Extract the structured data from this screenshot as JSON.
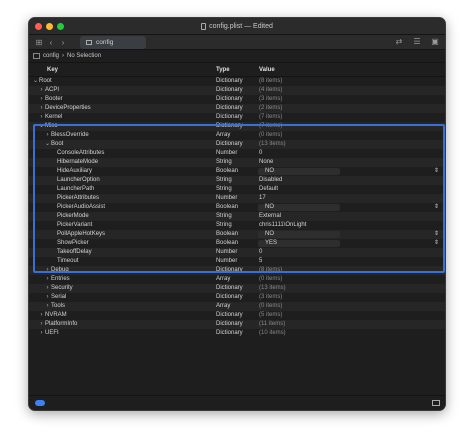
{
  "window": {
    "title": "config.plist — Edited"
  },
  "toolbar": {
    "tab_label": "config"
  },
  "pathbar": {
    "root": "config",
    "selection": "No Selection"
  },
  "columns": {
    "key": "Key",
    "type": "Type",
    "value": "Value"
  },
  "rows": [
    {
      "key": "Root",
      "type": "Dictionary",
      "value": "(8 items)",
      "indent": 0,
      "chev": "⌄"
    },
    {
      "key": "ACPI",
      "type": "Dictionary",
      "value": "(4 items)",
      "indent": 1,
      "chev": "›"
    },
    {
      "key": "Booter",
      "type": "Dictionary",
      "value": "(3 items)",
      "indent": 1,
      "chev": "›"
    },
    {
      "key": "DeviceProperties",
      "type": "Dictionary",
      "value": "(2 items)",
      "indent": 1,
      "chev": "›"
    },
    {
      "key": "Kernel",
      "type": "Dictionary",
      "value": "(7 items)",
      "indent": 1,
      "chev": "›"
    },
    {
      "key": "Misc",
      "type": "Dictionary",
      "value": "(7 items)",
      "indent": 1,
      "chev": "⌄"
    },
    {
      "key": "BlessOverride",
      "type": "Array",
      "value": "(0 items)",
      "indent": 2,
      "chev": "›"
    },
    {
      "key": "Boot",
      "type": "Dictionary",
      "value": "(13 items)",
      "indent": 2,
      "chev": "⌄"
    },
    {
      "key": "ConsoleAttributes",
      "type": "Number",
      "value": "0",
      "indent": 3,
      "chev": ""
    },
    {
      "key": "HibernateMode",
      "type": "String",
      "value": "None",
      "indent": 3,
      "chev": ""
    },
    {
      "key": "HideAuxiliary",
      "type": "Boolean",
      "value": "NO",
      "indent": 3,
      "chev": "",
      "bool": true
    },
    {
      "key": "LauncherOption",
      "type": "String",
      "value": "Disabled",
      "indent": 3,
      "chev": ""
    },
    {
      "key": "LauncherPath",
      "type": "String",
      "value": "Default",
      "indent": 3,
      "chev": ""
    },
    {
      "key": "PickerAttributes",
      "type": "Number",
      "value": "17",
      "indent": 3,
      "chev": ""
    },
    {
      "key": "PickerAudioAssist",
      "type": "Boolean",
      "value": "NO",
      "indent": 3,
      "chev": "",
      "bool": true
    },
    {
      "key": "PickerMode",
      "type": "String",
      "value": "External",
      "indent": 3,
      "chev": ""
    },
    {
      "key": "PickerVariant",
      "type": "String",
      "value": "chris1111\\OnLight",
      "indent": 3,
      "chev": ""
    },
    {
      "key": "PollAppleHotKeys",
      "type": "Boolean",
      "value": "NO",
      "indent": 3,
      "chev": "",
      "bool": true
    },
    {
      "key": "ShowPicker",
      "type": "Boolean",
      "value": "YES",
      "indent": 3,
      "chev": "",
      "bool": true
    },
    {
      "key": "TakeoffDelay",
      "type": "Number",
      "value": "0",
      "indent": 3,
      "chev": ""
    },
    {
      "key": "Timeout",
      "type": "Number",
      "value": "5",
      "indent": 3,
      "chev": ""
    },
    {
      "key": "Debug",
      "type": "Dictionary",
      "value": "(8 items)",
      "indent": 2,
      "chev": "›"
    },
    {
      "key": "Entries",
      "type": "Array",
      "value": "(0 items)",
      "indent": 2,
      "chev": "›"
    },
    {
      "key": "Security",
      "type": "Dictionary",
      "value": "(13 items)",
      "indent": 2,
      "chev": "›"
    },
    {
      "key": "Serial",
      "type": "Dictionary",
      "value": "(3 items)",
      "indent": 2,
      "chev": "›"
    },
    {
      "key": "Tools",
      "type": "Array",
      "value": "(0 items)",
      "indent": 2,
      "chev": "›"
    },
    {
      "key": "NVRAM",
      "type": "Dictionary",
      "value": "(5 items)",
      "indent": 1,
      "chev": "›"
    },
    {
      "key": "PlatformInfo",
      "type": "Dictionary",
      "value": "(11 items)",
      "indent": 1,
      "chev": "›"
    },
    {
      "key": "UEFI",
      "type": "Dictionary",
      "value": "(10 items)",
      "indent": 1,
      "chev": "›"
    }
  ],
  "colors": {
    "highlight": "#3b6fd8",
    "accent": "#3b82f6"
  }
}
